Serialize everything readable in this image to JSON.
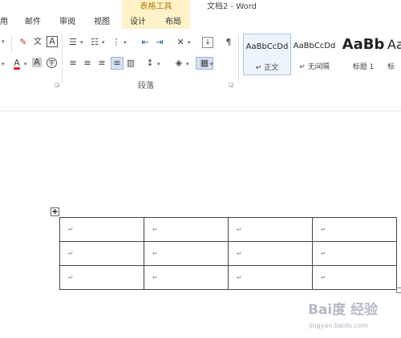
{
  "window": {
    "title": "文档2 - Word",
    "contextual_group": "表格工具"
  },
  "tabs": [
    {
      "label": "用"
    },
    {
      "label": "邮件"
    },
    {
      "label": "审阅"
    },
    {
      "label": "视图"
    },
    {
      "label": "设计"
    },
    {
      "label": "布局"
    }
  ],
  "ribbon": {
    "paragraph_group_label": "段落",
    "styles": [
      {
        "sample": "AaBbCcDd",
        "name": "↵ 正文"
      },
      {
        "sample": "AaBbCcDd",
        "name": "↵ 无间隔"
      },
      {
        "sample": "AaBb",
        "name": "标题 1"
      },
      {
        "sample": "Aa",
        "name": "标"
      }
    ],
    "icons": {
      "font_color_letter": "A",
      "font_color": "#e02020",
      "highlight_letter": "A",
      "phonetic": "文",
      "char_border": "A",
      "enclose": "字"
    }
  },
  "document": {
    "table": {
      "rows": [
        [
          "↵",
          "↵",
          "↵",
          "↵"
        ],
        [
          "↵",
          "↵",
          "↵",
          "↵"
        ],
        [
          "↵",
          "↵",
          "↵",
          "↵"
        ]
      ]
    }
  },
  "watermark": {
    "logo": "Bai度 经验",
    "sub": "",
    "url": "jingyan.baidu.com"
  }
}
